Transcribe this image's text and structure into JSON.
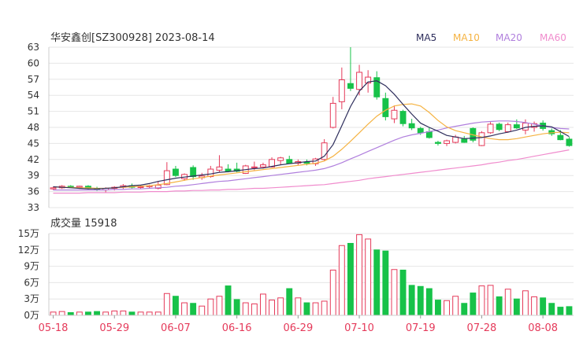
{
  "header": {
    "title": "华安鑫创[SZ300928] 2023-08-14",
    "legend": [
      {
        "label": "MA5",
        "color": "#2e2e5c"
      },
      {
        "label": "MA10",
        "color": "#f5b342"
      },
      {
        "label": "MA20",
        "color": "#b07fdd"
      },
      {
        "label": "MA60",
        "color": "#f08ccd"
      }
    ]
  },
  "volume_header": {
    "label": "成交量",
    "value": "15918"
  },
  "colors": {
    "up": "#e53a5a",
    "down": "#17c249",
    "grid": "#e6e6e6",
    "axis": "#333333",
    "xtick": "#e53a5a"
  },
  "chart_data": [
    {
      "type": "candlestick",
      "ylim": [
        33,
        63
      ],
      "yticks": [
        "63",
        "60",
        "57",
        "54",
        "51",
        "48",
        "45",
        "42",
        "39",
        "36",
        "33"
      ],
      "xtick_labels": [
        "05-18",
        "05-29",
        "06-07",
        "06-16",
        "06-29",
        "07-10",
        "07-19",
        "07-28",
        "08-08"
      ],
      "xtick_index": [
        0,
        7,
        14,
        21,
        28,
        35,
        42,
        49,
        56
      ],
      "ohlc": [
        [
          36.5,
          36.9,
          36.3,
          36.7
        ],
        [
          36.7,
          37.2,
          36.5,
          37.0
        ],
        [
          37.0,
          37.2,
          36.7,
          36.8
        ],
        [
          36.8,
          37.1,
          36.5,
          37.0
        ],
        [
          37.0,
          37.2,
          36.4,
          36.6
        ],
        [
          36.6,
          36.9,
          36.1,
          36.3
        ],
        [
          36.3,
          36.8,
          35.8,
          36.6
        ],
        [
          36.6,
          37.0,
          36.2,
          36.8
        ],
        [
          36.8,
          37.4,
          36.5,
          37.1
        ],
        [
          37.1,
          37.5,
          36.6,
          36.8
        ],
        [
          36.8,
          37.2,
          36.5,
          36.9
        ],
        [
          36.9,
          37.3,
          36.6,
          37.1
        ],
        [
          36.6,
          38.0,
          36.4,
          37.2
        ],
        [
          37.3,
          41.5,
          37.2,
          39.9
        ],
        [
          40.2,
          40.8,
          38.7,
          39.0
        ],
        [
          38.4,
          39.4,
          38.0,
          39.2
        ],
        [
          40.5,
          40.9,
          38.2,
          38.8
        ],
        [
          38.6,
          39.5,
          38.2,
          38.9
        ],
        [
          38.8,
          40.8,
          38.6,
          40.2
        ],
        [
          40.0,
          42.8,
          39.7,
          40.6
        ],
        [
          40.2,
          41.1,
          39.6,
          39.8
        ],
        [
          40.2,
          41.4,
          39.6,
          39.8
        ],
        [
          39.4,
          41.0,
          39.3,
          40.8
        ],
        [
          40.5,
          41.6,
          40.0,
          40.6
        ],
        [
          40.6,
          41.4,
          40.3,
          41.0
        ],
        [
          40.6,
          42.4,
          40.5,
          42.0
        ],
        [
          41.8,
          42.5,
          41.0,
          42.3
        ],
        [
          42.0,
          42.7,
          41.2,
          41.3
        ],
        [
          41.3,
          42.0,
          40.9,
          41.6
        ],
        [
          41.5,
          42.0,
          40.9,
          41.3
        ],
        [
          41.2,
          42.3,
          40.8,
          42.1
        ],
        [
          42.0,
          45.8,
          41.8,
          45.1
        ],
        [
          48.0,
          53.7,
          47.8,
          52.5
        ],
        [
          52.8,
          59.2,
          51.4,
          56.9
        ],
        [
          56.2,
          63.0,
          54.8,
          55.3
        ],
        [
          55.1,
          59.7,
          54.0,
          58.3
        ],
        [
          56.3,
          58.7,
          54.5,
          57.4
        ],
        [
          57.3,
          58.5,
          53.2,
          53.7
        ],
        [
          53.4,
          54.5,
          49.3,
          50.0
        ],
        [
          49.6,
          52.1,
          48.8,
          51.2
        ],
        [
          51.0,
          51.3,
          48.2,
          48.7
        ],
        [
          48.7,
          49.6,
          47.5,
          47.9
        ],
        [
          47.8,
          48.1,
          46.6,
          47.0
        ],
        [
          47.2,
          48.0,
          45.9,
          46.1
        ],
        [
          45.2,
          45.5,
          44.6,
          45.0
        ],
        [
          45.0,
          45.7,
          44.5,
          45.5
        ],
        [
          45.2,
          46.6,
          45.0,
          46.2
        ],
        [
          45.8,
          46.4,
          45.1,
          45.2
        ],
        [
          47.8,
          48.0,
          45.2,
          45.6
        ],
        [
          44.6,
          47.3,
          44.5,
          47.0
        ],
        [
          47.0,
          49.0,
          46.8,
          48.6
        ],
        [
          48.6,
          48.9,
          47.3,
          47.6
        ],
        [
          47.2,
          48.9,
          47.0,
          48.5
        ],
        [
          48.5,
          49.5,
          47.7,
          47.9
        ],
        [
          47.5,
          49.5,
          46.7,
          48.8
        ],
        [
          48.0,
          49.1,
          47.2,
          48.7
        ],
        [
          48.8,
          49.3,
          47.4,
          47.8
        ],
        [
          47.4,
          47.8,
          46.4,
          46.8
        ],
        [
          46.5,
          47.5,
          45.6,
          45.7
        ],
        [
          45.8,
          46.2,
          44.4,
          44.6
        ]
      ],
      "ma5": [
        36.9,
        36.8,
        36.7,
        36.6,
        36.5,
        36.5,
        36.6,
        36.7,
        36.9,
        37.1,
        37.2,
        37.5,
        37.9,
        38.2,
        38.5,
        38.7,
        38.9,
        39.1,
        39.3,
        39.6,
        39.7,
        39.9,
        40.1,
        40.3,
        40.4,
        40.7,
        41.0,
        41.2,
        41.4,
        41.6,
        41.7,
        42.6,
        44.8,
        48.3,
        51.9,
        54.8,
        56.5,
        56.7,
        55.8,
        54.2,
        52.3,
        50.5,
        48.8,
        48.0,
        47.3,
        46.5,
        46.2,
        45.9,
        46.0,
        46.1,
        46.4,
        46.8,
        47.1,
        47.5,
        48.0,
        48.2,
        48.3,
        48.1,
        47.2,
        46.3
      ],
      "ma10": [
        36.9,
        36.8,
        36.8,
        36.7,
        36.7,
        36.6,
        36.6,
        36.7,
        36.8,
        36.9,
        37.0,
        37.1,
        37.3,
        37.5,
        37.8,
        38.1,
        38.4,
        38.6,
        38.9,
        39.1,
        39.3,
        39.5,
        39.7,
        39.9,
        40.1,
        40.3,
        40.5,
        40.7,
        40.9,
        41.1,
        41.3,
        41.7,
        42.6,
        43.9,
        45.4,
        47.0,
        48.6,
        50.1,
        51.2,
        52.0,
        52.3,
        52.4,
        52.0,
        50.8,
        49.3,
        48.1,
        47.4,
        47.0,
        46.6,
        46.2,
        45.9,
        45.7,
        45.7,
        45.9,
        46.2,
        46.5,
        46.8,
        47.0,
        47.1,
        47.0
      ],
      "ma20": [
        36.3,
        36.3,
        36.3,
        36.3,
        36.3,
        36.3,
        36.3,
        36.4,
        36.4,
        36.5,
        36.5,
        36.6,
        36.7,
        36.8,
        37.0,
        37.1,
        37.3,
        37.5,
        37.7,
        37.9,
        38.0,
        38.2,
        38.4,
        38.6,
        38.8,
        39.0,
        39.2,
        39.4,
        39.6,
        39.8,
        40.0,
        40.3,
        40.8,
        41.4,
        42.1,
        42.8,
        43.5,
        44.2,
        44.9,
        45.6,
        46.2,
        46.6,
        46.9,
        47.2,
        47.5,
        47.9,
        48.2,
        48.5,
        48.8,
        49.0,
        49.1,
        49.2,
        49.2,
        49.1,
        48.9,
        48.6,
        48.3,
        48.0,
        47.8,
        47.7
      ],
      "ma60": [
        35.7,
        35.7,
        35.7,
        35.7,
        35.8,
        35.8,
        35.8,
        35.8,
        35.9,
        35.9,
        35.9,
        36.0,
        36.0,
        36.0,
        36.1,
        36.1,
        36.2,
        36.2,
        36.3,
        36.3,
        36.4,
        36.4,
        36.5,
        36.6,
        36.6,
        36.7,
        36.8,
        36.9,
        37.0,
        37.1,
        37.2,
        37.3,
        37.5,
        37.7,
        37.9,
        38.1,
        38.4,
        38.6,
        38.8,
        39.0,
        39.2,
        39.4,
        39.6,
        39.8,
        40.0,
        40.2,
        40.4,
        40.6,
        40.8,
        41.0,
        41.3,
        41.5,
        41.8,
        42.0,
        42.3,
        42.6,
        42.9,
        43.2,
        43.5,
        43.8
      ]
    },
    {
      "type": "bar",
      "ylim": [
        0,
        15
      ],
      "yticks": [
        "15万",
        "12万",
        "9万",
        "6万",
        "3万",
        "0万"
      ],
      "values": [
        0.6,
        0.7,
        0.5,
        0.6,
        0.6,
        0.7,
        0.6,
        0.8,
        0.8,
        0.6,
        0.6,
        0.6,
        0.6,
        4.0,
        3.5,
        2.3,
        2.2,
        1.7,
        3.0,
        3.5,
        5.4,
        2.9,
        2.3,
        2.1,
        3.9,
        2.8,
        3.2,
        4.9,
        3.2,
        2.3,
        2.3,
        2.6,
        8.3,
        12.8,
        13.2,
        14.8,
        14.0,
        12.0,
        11.8,
        8.4,
        8.3,
        5.5,
        5.3,
        4.9,
        2.8,
        2.7,
        3.5,
        2.2,
        4.1,
        5.4,
        5.5,
        3.4,
        4.8,
        3.0,
        4.5,
        3.4,
        3.2,
        2.2,
        1.5,
        1.6
      ]
    }
  ]
}
